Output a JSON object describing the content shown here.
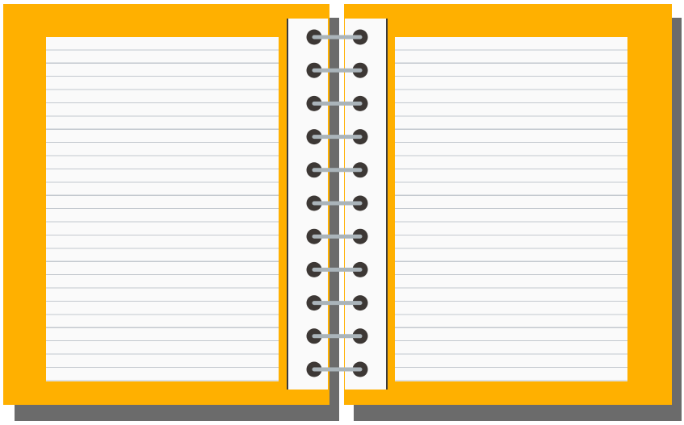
{
  "notebook": {
    "ring_count": 11,
    "colors": {
      "cover": "#ffb000",
      "paper": "#fafafa",
      "rule_line": "#c3c8ce",
      "shadow": "#6b6b6b",
      "hole": "#3d3835",
      "wire": "#aab4ba"
    },
    "icon": "spiral-notebook-open"
  }
}
